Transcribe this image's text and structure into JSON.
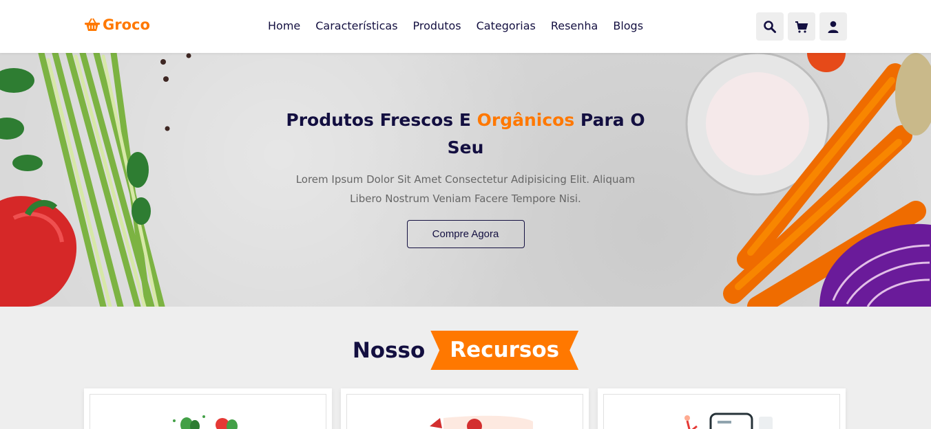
{
  "header": {
    "logo_text": "Groco",
    "nav": [
      {
        "label": "Home"
      },
      {
        "label": "Características"
      },
      {
        "label": "Produtos"
      },
      {
        "label": "Categorias"
      },
      {
        "label": "Resenha"
      },
      {
        "label": "Blogs"
      }
    ],
    "icons": [
      "search-icon",
      "cart-icon",
      "user-icon"
    ]
  },
  "hero": {
    "title_start": "Produtos Frescos E ",
    "title_accent": "Orgânicos",
    "title_end": " Para O Seu",
    "description": "Lorem Ipsum Dolor Sit Amet Consectetur Adipisicing Elit. Aliquam Libero Nostrum Veniam Facere Tempore Nisi.",
    "button_label": "Compre Agora"
  },
  "features": {
    "heading_plain": "Nosso",
    "heading_accent": "Recursos"
  },
  "colors": {
    "accent": "#ff7800",
    "dark": "#130f40",
    "background": "#eeeeee"
  }
}
